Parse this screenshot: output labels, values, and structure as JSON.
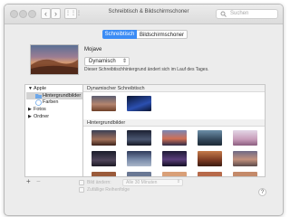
{
  "window": {
    "title": "Schreibtisch & Bildschirmschoner"
  },
  "toolbar": {
    "back_icon": "chevron-left-icon",
    "forward_icon": "chevron-right-icon",
    "grid_icon": "grid-icon",
    "grid_label": "⋮⋮⋮"
  },
  "search": {
    "placeholder": "Suchen"
  },
  "tabs": [
    {
      "label": "Schreibtisch",
      "selected": true
    },
    {
      "label": "Bildschirmschoner",
      "selected": false
    }
  ],
  "wallpaper": {
    "name": "Mojave",
    "mode": "Dynamisch",
    "description": "Dieser Schreibtischhintergrund ändert sich im Lauf des Tages."
  },
  "sidebar": {
    "apple": "Apple",
    "items": [
      "Hintergrundbilder",
      "Farben"
    ],
    "photos": "Fotos",
    "folders": "Ordner"
  },
  "sections": {
    "dynamic": "Dynamischer Schreibtisch",
    "backgrounds": "Hintergrundbilder"
  },
  "bottom": {
    "plus": "+",
    "minus": "−",
    "change_label": "Bild ändern:",
    "interval": "Alle 30 Minuten",
    "random_label": "Zufällige Reihenfolge"
  },
  "help": "?"
}
